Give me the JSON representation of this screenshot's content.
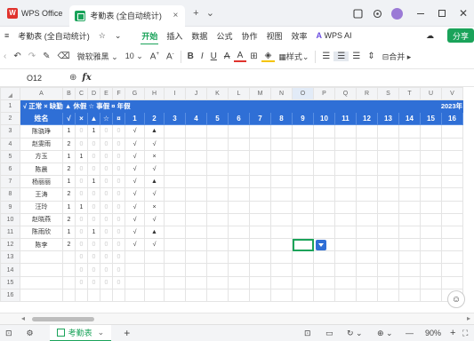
{
  "titlebar": {
    "app_label": "WPS Office",
    "doc_tab_label": "考勤表 (全自动统计)",
    "close_tab": "×",
    "new_tab": "+",
    "more": "⌄",
    "avatar_letter": "W"
  },
  "menubar": {
    "file_label": "考勤表 (全自动统计)",
    "items": [
      "开始",
      "插入",
      "数据",
      "公式",
      "协作",
      "视图",
      "效率"
    ],
    "active_item": "开始",
    "ai_label": "WPS AI",
    "share_label": "分享"
  },
  "toolbar": {
    "font_name": "微软雅黑",
    "font_size": "10",
    "style_label": "样式",
    "merge_label": "合并"
  },
  "formulabar": {
    "cell_ref": "O12",
    "fx": "fx"
  },
  "sheet": {
    "col_headers": [
      "A",
      "B",
      "C",
      "D",
      "E",
      "F",
      "G",
      "H",
      "I",
      "J",
      "K",
      "L",
      "M",
      "N",
      "O",
      "P",
      "Q",
      "R",
      "S",
      "T",
      "U",
      "V"
    ],
    "legend_text": "√ 正常 × 缺勤 ▲ 休假 ☆ 事假 ¤ 年假",
    "year_text": "2023年",
    "head": [
      "姓名",
      "√",
      "×",
      "▲",
      "☆",
      "¤",
      "1",
      "2",
      "3",
      "4",
      "5",
      "6",
      "7",
      "8",
      "9",
      "10",
      "11",
      "12",
      "13",
      "14",
      "15",
      "16"
    ],
    "rows": [
      {
        "n": "3",
        "name": "陈骁琤",
        "b": "1",
        "c": "0",
        "d": "1",
        "e": "0",
        "f": "0",
        "g": "√",
        "h": "▲"
      },
      {
        "n": "4",
        "name": "赵雯雨",
        "b": "2",
        "c": "0",
        "d": "0",
        "e": "0",
        "f": "0",
        "g": "√",
        "h": "√"
      },
      {
        "n": "5",
        "name": "方玉",
        "b": "1",
        "c": "1",
        "d": "0",
        "e": "0",
        "f": "0",
        "g": "√",
        "h": "×"
      },
      {
        "n": "6",
        "name": "陈晨",
        "b": "2",
        "c": "0",
        "d": "0",
        "e": "0",
        "f": "0",
        "g": "√",
        "h": "√"
      },
      {
        "n": "7",
        "name": "杨丽丽",
        "b": "1",
        "c": "0",
        "d": "1",
        "e": "0",
        "f": "0",
        "g": "√",
        "h": "▲"
      },
      {
        "n": "8",
        "name": "王涛",
        "b": "2",
        "c": "0",
        "d": "0",
        "e": "0",
        "f": "0",
        "g": "√",
        "h": "√"
      },
      {
        "n": "9",
        "name": "汪玲",
        "b": "1",
        "c": "1",
        "d": "0",
        "e": "0",
        "f": "0",
        "g": "√",
        "h": "×"
      },
      {
        "n": "10",
        "name": "赵晓燕",
        "b": "2",
        "c": "0",
        "d": "0",
        "e": "0",
        "f": "0",
        "g": "√",
        "h": "√"
      },
      {
        "n": "11",
        "name": "陈雨欣",
        "b": "1",
        "c": "0",
        "d": "1",
        "e": "0",
        "f": "0",
        "g": "√",
        "h": "▲"
      },
      {
        "n": "12",
        "name": "陈李",
        "b": "2",
        "c": "0",
        "d": "0",
        "e": "0",
        "f": "0",
        "g": "√",
        "h": "√"
      },
      {
        "n": "13",
        "name": "",
        "b": "",
        "c": "0",
        "d": "0",
        "e": "0",
        "f": "0",
        "g": "",
        "h": ""
      },
      {
        "n": "14",
        "name": "",
        "b": "",
        "c": "0",
        "d": "0",
        "e": "0",
        "f": "0",
        "g": "",
        "h": ""
      },
      {
        "n": "15",
        "name": "",
        "b": "",
        "c": "0",
        "d": "0",
        "e": "0",
        "f": "0",
        "g": "",
        "h": ""
      },
      {
        "n": "16",
        "name": "",
        "b": "",
        "c": "",
        "d": "",
        "e": "",
        "f": "",
        "g": "",
        "h": ""
      }
    ]
  },
  "statusbar": {
    "sheet_name": "考勤表",
    "add_sheet": "+",
    "zoom": "90%"
  },
  "colors": {
    "accent_green": "#1aa35a",
    "header_blue": "#2f6fd6",
    "wps_red": "#e0332d"
  }
}
